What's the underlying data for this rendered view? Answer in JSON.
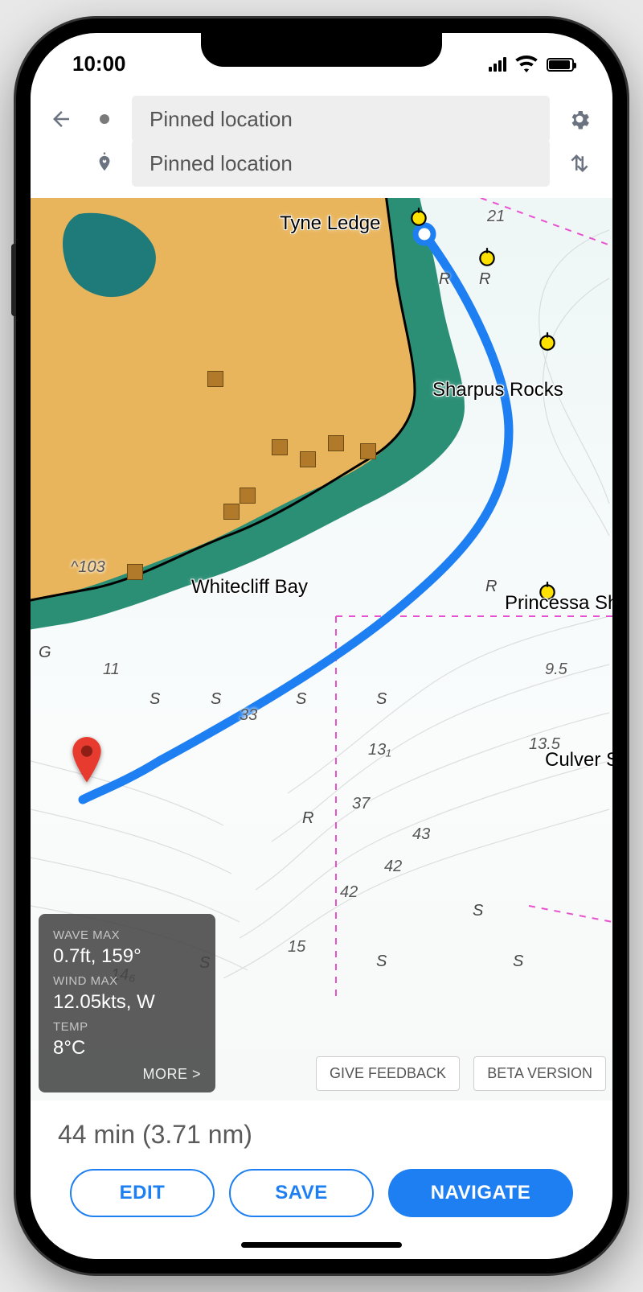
{
  "status": {
    "time": "10:00"
  },
  "header": {
    "origin_label": "Pinned location",
    "destination_label": "Pinned location"
  },
  "map": {
    "places": {
      "tyne_ledge": "Tyne Ledge",
      "sharpus_rocks": "Sharpus Rocks",
      "whitecliff_bay": "Whitecliff Bay",
      "princessa": "Princessa Sh",
      "culver": "Culver S"
    },
    "depths": {
      "d21": "21",
      "d9_5": "9.5",
      "d33": "33",
      "d13_1": "13₁",
      "d13_5": "13.5",
      "d37": "37",
      "d43": "43",
      "d42a": "42",
      "d42b": "42",
      "d15": "15",
      "d11": "11",
      "d14_6": "14₆",
      "d103": "^103"
    },
    "letters": {
      "r1": "R",
      "r2": "R",
      "r3": "R",
      "r4": "R",
      "s1": "S",
      "s2": "S",
      "s3": "S",
      "s4": "S",
      "s5": "S",
      "s6": "S",
      "s7": "S",
      "s8": "S",
      "g1": "G"
    }
  },
  "weather": {
    "wave_label": "WAVE MAX",
    "wave_value": "0.7ft, 159°",
    "wind_label": "WIND MAX",
    "wind_value": "12.05kts, W",
    "temp_label": "TEMP",
    "temp_value": "8°C",
    "more": "MORE >"
  },
  "floating": {
    "feedback": "GIVE FEEDBACK",
    "beta": "BETA VERSION"
  },
  "bottom": {
    "summary": "44 min (3.71 nm)",
    "edit": "EDIT",
    "save": "SAVE",
    "navigate": "NAVIGATE"
  }
}
